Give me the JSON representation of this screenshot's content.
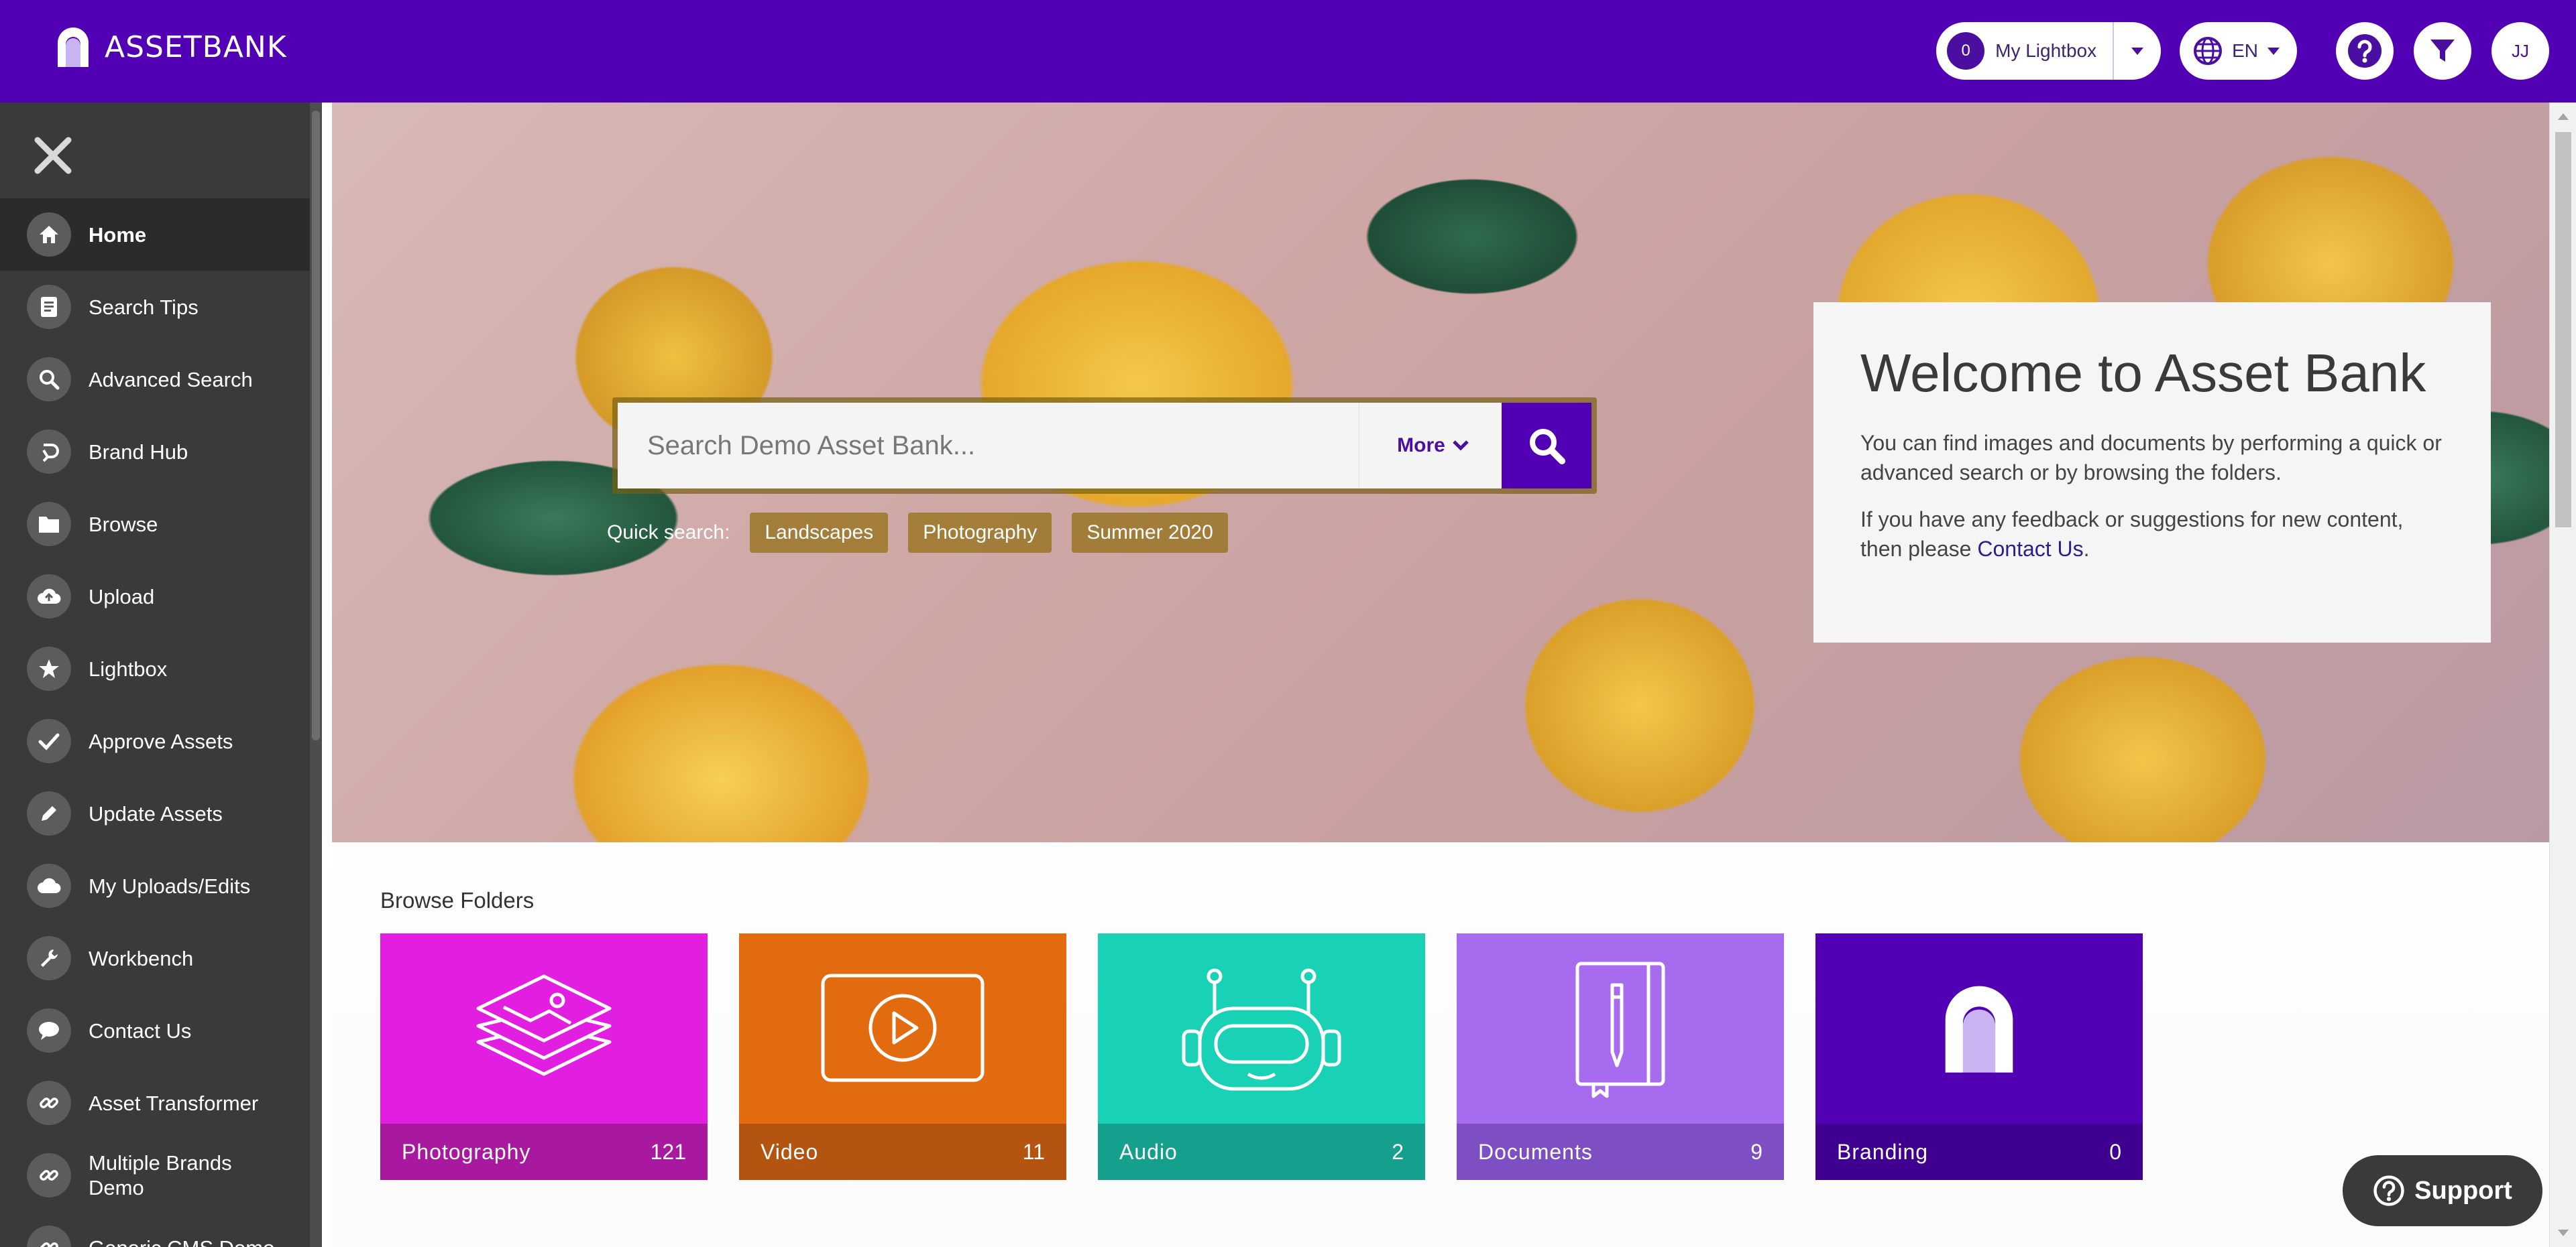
{
  "app": {
    "name": "ASSETBANK"
  },
  "header": {
    "lightbox_count": "0",
    "lightbox_label": "My Lightbox",
    "language": "EN",
    "user_initials": "JJ"
  },
  "sidebar": {
    "items": [
      {
        "label": "Home",
        "icon": "home-icon"
      },
      {
        "label": "Search Tips",
        "icon": "document-icon"
      },
      {
        "label": "Advanced Search",
        "icon": "search-icon"
      },
      {
        "label": "Brand Hub",
        "icon": "brand-hub-icon"
      },
      {
        "label": "Browse",
        "icon": "folder-icon"
      },
      {
        "label": "Upload",
        "icon": "cloud-upload-icon"
      },
      {
        "label": "Lightbox",
        "icon": "star-icon"
      },
      {
        "label": "Approve Assets",
        "icon": "check-icon"
      },
      {
        "label": "Update Assets",
        "icon": "pencil-icon"
      },
      {
        "label": "My Uploads/Edits",
        "icon": "cloud-icon"
      },
      {
        "label": "Workbench",
        "icon": "wrench-icon"
      },
      {
        "label": "Contact Us",
        "icon": "chat-icon"
      },
      {
        "label": "Asset Transformer",
        "icon": "link-icon"
      },
      {
        "label": "Multiple Brands Demo",
        "icon": "link-icon"
      },
      {
        "label": "Generic CMS Demo",
        "icon": "link-icon"
      }
    ]
  },
  "search": {
    "placeholder": "Search Demo Asset Bank...",
    "more_label": "More",
    "quick_label": "Quick search:",
    "quick_tags": [
      "Landscapes",
      "Photography",
      "Summer 2020"
    ]
  },
  "welcome": {
    "title": "Welcome to Asset Bank",
    "para1": "You can find images and documents by performing a quick or advanced search or by browsing the folders.",
    "para2_prefix": "If you have any feedback or suggestions for new content, then please",
    "para2_link": "Contact Us",
    "para2_suffix": "."
  },
  "browse": {
    "title": "Browse Folders",
    "folders": [
      {
        "name": "Photography",
        "count": "121",
        "color": "#e21ee0",
        "foot": "#a8199f",
        "icon": "photo-stack-icon"
      },
      {
        "name": "Video",
        "count": "11",
        "color": "#e26b10",
        "foot": "#b35510",
        "icon": "video-play-icon"
      },
      {
        "name": "Audio",
        "count": "2",
        "color": "#19d2b5",
        "foot": "#14a08c",
        "icon": "robot-icon"
      },
      {
        "name": "Documents",
        "count": "9",
        "color": "#a66bef",
        "foot": "#7d4fc2",
        "icon": "notebook-icon"
      },
      {
        "name": "Branding",
        "count": "0",
        "color": "#5200b3",
        "foot": "#3f0090",
        "icon": "assetbank-logo-icon"
      }
    ]
  },
  "support": {
    "label": "Support"
  },
  "colors": {
    "brand": "#5200b3",
    "sidebar": "#3a3a3a"
  }
}
